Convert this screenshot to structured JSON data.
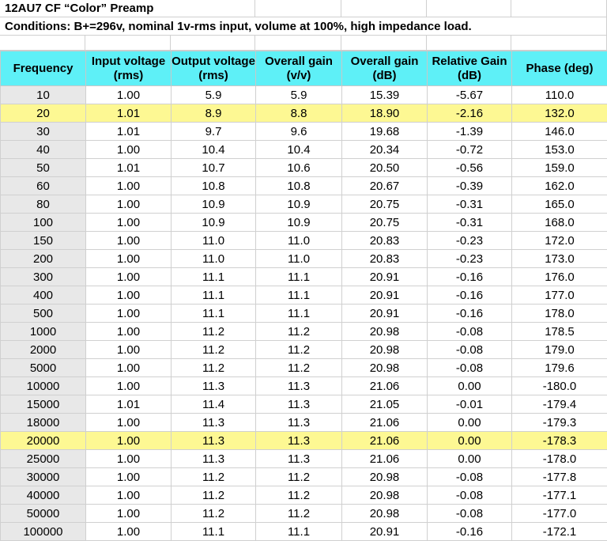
{
  "sheet": {
    "title": "12AU7 CF “Color” Preamp",
    "conditions": "Conditions: B+=296v, nominal 1v-rms input, volume at 100%, high impedance load.",
    "headers": [
      [
        "Frequency",
        ""
      ],
      [
        "Input voltage",
        "(rms)"
      ],
      [
        "Output voltage",
        "(rms)"
      ],
      [
        "Overall gain",
        "(v/v)"
      ],
      [
        "Overall gain",
        "(dB)"
      ],
      [
        "Relative Gain",
        "(dB)"
      ],
      [
        "Phase (deg)",
        ""
      ]
    ],
    "colors": {
      "header_bg": "#5ef0f7",
      "highlight_bg": "#fdf893",
      "frequency_col_bg": "#e8e8e8"
    },
    "rows": [
      {
        "highlight": false,
        "cells": [
          "10",
          "1.00",
          "5.9",
          "5.9",
          "15.39",
          "-5.67",
          "110.0"
        ]
      },
      {
        "highlight": true,
        "cells": [
          "20",
          "1.01",
          "8.9",
          "8.8",
          "18.90",
          "-2.16",
          "132.0"
        ]
      },
      {
        "highlight": false,
        "cells": [
          "30",
          "1.01",
          "9.7",
          "9.6",
          "19.68",
          "-1.39",
          "146.0"
        ]
      },
      {
        "highlight": false,
        "cells": [
          "40",
          "1.00",
          "10.4",
          "10.4",
          "20.34",
          "-0.72",
          "153.0"
        ]
      },
      {
        "highlight": false,
        "cells": [
          "50",
          "1.01",
          "10.7",
          "10.6",
          "20.50",
          "-0.56",
          "159.0"
        ]
      },
      {
        "highlight": false,
        "cells": [
          "60",
          "1.00",
          "10.8",
          "10.8",
          "20.67",
          "-0.39",
          "162.0"
        ]
      },
      {
        "highlight": false,
        "cells": [
          "80",
          "1.00",
          "10.9",
          "10.9",
          "20.75",
          "-0.31",
          "165.0"
        ]
      },
      {
        "highlight": false,
        "cells": [
          "100",
          "1.00",
          "10.9",
          "10.9",
          "20.75",
          "-0.31",
          "168.0"
        ]
      },
      {
        "highlight": false,
        "cells": [
          "150",
          "1.00",
          "11.0",
          "11.0",
          "20.83",
          "-0.23",
          "172.0"
        ]
      },
      {
        "highlight": false,
        "cells": [
          "200",
          "1.00",
          "11.0",
          "11.0",
          "20.83",
          "-0.23",
          "173.0"
        ]
      },
      {
        "highlight": false,
        "cells": [
          "300",
          "1.00",
          "11.1",
          "11.1",
          "20.91",
          "-0.16",
          "176.0"
        ]
      },
      {
        "highlight": false,
        "cells": [
          "400",
          "1.00",
          "11.1",
          "11.1",
          "20.91",
          "-0.16",
          "177.0"
        ]
      },
      {
        "highlight": false,
        "cells": [
          "500",
          "1.00",
          "11.1",
          "11.1",
          "20.91",
          "-0.16",
          "178.0"
        ]
      },
      {
        "highlight": false,
        "cells": [
          "1000",
          "1.00",
          "11.2",
          "11.2",
          "20.98",
          "-0.08",
          "178.5"
        ]
      },
      {
        "highlight": false,
        "cells": [
          "2000",
          "1.00",
          "11.2",
          "11.2",
          "20.98",
          "-0.08",
          "179.0"
        ]
      },
      {
        "highlight": false,
        "cells": [
          "5000",
          "1.00",
          "11.2",
          "11.2",
          "20.98",
          "-0.08",
          "179.6"
        ]
      },
      {
        "highlight": false,
        "cells": [
          "10000",
          "1.00",
          "11.3",
          "11.3",
          "21.06",
          "0.00",
          "-180.0"
        ]
      },
      {
        "highlight": false,
        "cells": [
          "15000",
          "1.01",
          "11.4",
          "11.3",
          "21.05",
          "-0.01",
          "-179.4"
        ]
      },
      {
        "highlight": false,
        "cells": [
          "18000",
          "1.00",
          "11.3",
          "11.3",
          "21.06",
          "0.00",
          "-179.3"
        ]
      },
      {
        "highlight": true,
        "cells": [
          "20000",
          "1.00",
          "11.3",
          "11.3",
          "21.06",
          "0.00",
          "-178.3"
        ]
      },
      {
        "highlight": false,
        "cells": [
          "25000",
          "1.00",
          "11.3",
          "11.3",
          "21.06",
          "0.00",
          "-178.0"
        ]
      },
      {
        "highlight": false,
        "cells": [
          "30000",
          "1.00",
          "11.2",
          "11.2",
          "20.98",
          "-0.08",
          "-177.8"
        ]
      },
      {
        "highlight": false,
        "cells": [
          "40000",
          "1.00",
          "11.2",
          "11.2",
          "20.98",
          "-0.08",
          "-177.1"
        ]
      },
      {
        "highlight": false,
        "cells": [
          "50000",
          "1.00",
          "11.2",
          "11.2",
          "20.98",
          "-0.08",
          "-177.0"
        ]
      },
      {
        "highlight": false,
        "cells": [
          "100000",
          "1.00",
          "11.1",
          "11.1",
          "20.91",
          "-0.16",
          "-172.1"
        ]
      }
    ]
  }
}
